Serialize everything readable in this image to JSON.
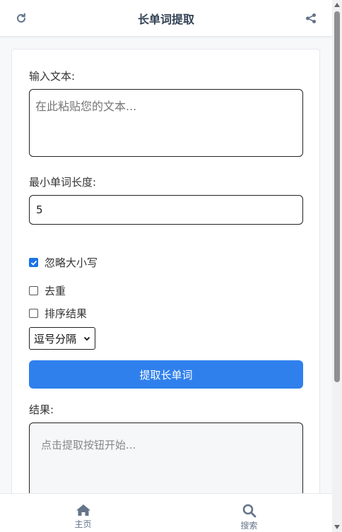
{
  "header": {
    "title": "长单词提取",
    "left_icon": "refresh-icon",
    "right_icon": "share-icon"
  },
  "form": {
    "text_label": "输入文本:",
    "text_placeholder": "在此粘贴您的文本...",
    "min_length_label": "最小单词长度:",
    "min_length_value": "5",
    "options": [
      {
        "label": "忽略大小写",
        "checked": true
      },
      {
        "label": "去重",
        "checked": false
      },
      {
        "label": "排序结果",
        "checked": false
      }
    ],
    "separator_selected": "逗号分隔",
    "extract_button": "提取长单词",
    "result_label": "结果:",
    "result_placeholder": "点击提取按钮开始..."
  },
  "bottom_nav": [
    {
      "label": "主页",
      "icon": "home-icon"
    },
    {
      "label": "搜索",
      "icon": "search-icon"
    }
  ],
  "colors": {
    "primary": "#2f80ed",
    "checkbox_accent": "#1a73e8",
    "icon_gray": "#64748b"
  }
}
